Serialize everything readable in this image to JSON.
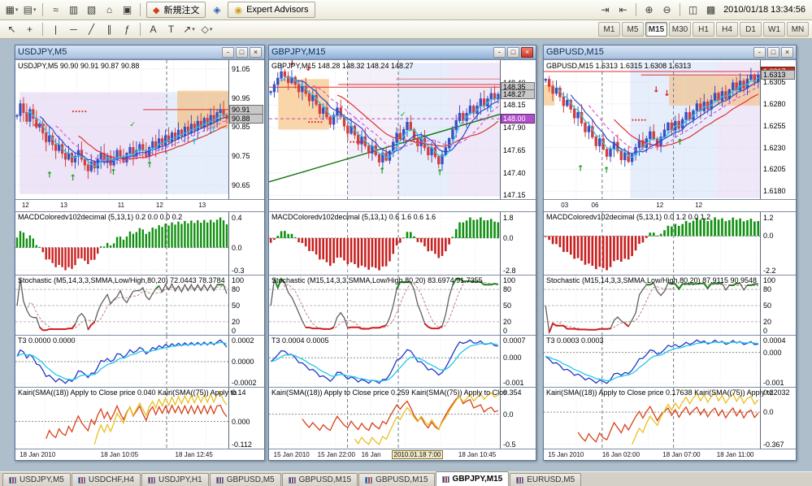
{
  "app": {
    "datetime": "2010/01/18 13:34:56"
  },
  "colors": {
    "bull": "#3a50c0",
    "bear": "#d04040",
    "ma_red": "#e03030",
    "ma_magenta": "#d858d8",
    "ma_blue": "#3048d0",
    "ma_cyan": "#28c8e8",
    "macd_pos": "#109010",
    "macd_neg": "#c82020",
    "stoch_main": "#606060",
    "stoch_high": "#208020",
    "stoch_low": "#d02020",
    "t3_line1": "#2038c8",
    "t3_line2": "#20c8e8",
    "kairi_fast": "#d84018",
    "kairi_slow": "#e8c020"
  },
  "toolbar_top": {
    "left": [
      {
        "name": "new-chart-button",
        "glyph": "▦",
        "dropdown": true
      },
      {
        "name": "profiles-button",
        "glyph": "▤",
        "dropdown": true
      },
      {
        "name": "separator"
      },
      {
        "name": "tick-chart-button",
        "glyph": "≈"
      },
      {
        "name": "market-watch-button",
        "glyph": "▥"
      },
      {
        "name": "data-window-button",
        "glyph": "▧"
      },
      {
        "name": "navigator-button",
        "glyph": "⌂"
      },
      {
        "name": "terminal-button",
        "glyph": "▣"
      }
    ],
    "new_order_icon": "◆",
    "new_order_label": "新規注文",
    "metaeditor_icon": "◈",
    "expert_advisors_icon": "◉",
    "expert_advisors_label": "Expert Advisors",
    "right": [
      {
        "name": "auto-scroll-button",
        "glyph": "⇥"
      },
      {
        "name": "chart-shift-button",
        "glyph": "⇤"
      },
      {
        "name": "separator"
      },
      {
        "name": "zoom-in-button",
        "glyph": "⊕"
      },
      {
        "name": "zoom-out-button",
        "glyph": "⊖"
      },
      {
        "name": "separator"
      },
      {
        "name": "tile-windows-button",
        "glyph": "◫"
      },
      {
        "name": "cascade-windows-button",
        "glyph": "▩"
      }
    ]
  },
  "toolbar_draw": {
    "items": [
      {
        "name": "cursor-tool",
        "glyph": "↖"
      },
      {
        "name": "crosshair-tool",
        "glyph": "+"
      },
      {
        "name": "separator"
      },
      {
        "name": "vertical-line-tool",
        "glyph": "|"
      },
      {
        "name": "horizontal-line-tool",
        "glyph": "─"
      },
      {
        "name": "trendline-tool",
        "glyph": "╱"
      },
      {
        "name": "channel-tool",
        "glyph": "∥"
      },
      {
        "name": "fibonacci-tool",
        "glyph": "ƒ"
      },
      {
        "name": "separator"
      },
      {
        "name": "text-tool",
        "glyph": "A"
      },
      {
        "name": "text-label-tool",
        "glyph": "T"
      },
      {
        "name": "arrows-tool",
        "glyph": "↗",
        "dropdown": true
      },
      {
        "name": "shapes-tool",
        "glyph": "◇",
        "dropdown": true
      }
    ]
  },
  "timeframes": {
    "items": [
      "M1",
      "M5",
      "M15",
      "M30",
      "H1",
      "H4",
      "D1",
      "W1",
      "MN"
    ],
    "active": "M15"
  },
  "tabs": {
    "items": [
      "USDJPY,M5",
      "USDCHF,H4",
      "USDJPY,H1",
      "GBPUSD,M5",
      "GBPUSD,M15",
      "GBPUSD,M15",
      "GBPJPY,M15",
      "EURUSD,M5"
    ],
    "active_index": 6
  },
  "windows": [
    {
      "title": "USDJPY,M5",
      "active": false,
      "header": "USDJPY,M5 90.90 90.91 90.87 90.88",
      "price_axis": {
        "min": 90.6,
        "max": 91.08,
        "ticks": [
          "91.05",
          "90.95",
          "90.85",
          "90.75",
          "90.65"
        ],
        "markers": [
          {
            "v": "90.91",
            "p": 90.91,
            "bg": "#c8c8c8",
            "fg": "#000000"
          },
          {
            "v": "90.88",
            "p": 90.88,
            "bg": "#c8c8c8",
            "fg": "#000000"
          }
        ]
      },
      "mid_axis": [
        {
          "t": "12",
          "f": 0.03
        },
        {
          "t": "13",
          "f": 0.21
        },
        {
          "t": "11",
          "f": 0.48
        },
        {
          "t": "12",
          "f": 0.66
        },
        {
          "t": "13",
          "f": 0.86
        }
      ],
      "bottom_axis": [
        {
          "t": "18 Jan 2010",
          "f": 0.02
        },
        {
          "t": "18 Jan 10:05",
          "f": 0.4
        },
        {
          "t": "18 Jan 12:45",
          "f": 0.75
        }
      ],
      "chart_data": {
        "type": "candlestick",
        "wick_amp": 0.035,
        "closes": [
          90.89,
          90.93,
          90.9,
          90.87,
          90.91,
          90.88,
          90.85,
          90.86,
          90.83,
          90.8,
          90.82,
          90.79,
          90.77,
          90.79,
          90.76,
          90.74,
          90.76,
          90.73,
          90.75,
          90.77,
          90.74,
          90.72,
          90.7,
          90.73,
          90.71,
          90.74,
          90.76,
          90.73,
          90.75,
          90.72,
          90.74,
          90.77,
          90.75,
          90.73,
          90.76,
          90.78,
          90.75,
          90.77,
          90.79,
          90.77,
          90.75,
          90.78,
          90.8,
          90.78,
          90.81,
          90.79,
          90.82,
          90.8,
          90.83,
          90.81,
          90.84,
          90.82,
          90.85,
          90.83,
          90.86,
          90.84,
          90.87,
          90.85,
          90.88,
          90.86,
          90.89,
          90.87,
          90.9,
          90.91,
          90.89,
          90.88
        ]
      },
      "regions": [
        {
          "x0": 0.02,
          "x1": 0.7,
          "p0": 90.97,
          "p1": 90.62,
          "c": "rgba(214,198,238,0.45)"
        },
        {
          "x0": 0.7,
          "x1": 1.0,
          "p0": 90.97,
          "p1": 90.62,
          "c": "rgba(205,220,248,0.50)"
        },
        {
          "x0": 0.76,
          "x1": 1.0,
          "p0": 90.975,
          "p1": 90.845,
          "c": "rgba(246,178,96,0.55)"
        }
      ],
      "hlines": [
        {
          "p": 90.91,
          "x0": 0.6,
          "x1": 1.0,
          "c": "#e03030"
        }
      ],
      "trendlines": [],
      "separators": [
        0.71
      ],
      "annotations": [
        {
          "g": "↑",
          "x": 0.16,
          "p": 90.685,
          "c": "#18a018"
        },
        {
          "g": "↑",
          "x": 0.27,
          "p": 90.675,
          "c": "#18a018"
        },
        {
          "g": "↑",
          "x": 0.46,
          "p": 90.695,
          "c": "#18a018"
        },
        {
          "g": "↑",
          "x": 0.63,
          "p": 90.72,
          "c": "#18a018"
        },
        {
          "g": "↑",
          "x": 0.84,
          "p": 90.8,
          "c": "#20c0d8"
        },
        {
          "g": "↑",
          "x": 0.93,
          "p": 90.84,
          "c": "#20c0d8"
        },
        {
          "g": "•••••",
          "x": 0.3,
          "p": 90.905,
          "c": "#e03030"
        },
        {
          "g": "•••••",
          "x": 0.12,
          "p": 90.86,
          "c": "#e03030"
        },
        {
          "g": "✓",
          "x": 0.55,
          "p": 90.86,
          "c": "#18a018"
        }
      ],
      "panes": [
        {
          "kind": "macd",
          "label": "MACDColoredv102decimal (5,13,1) 0.2 0.0 0.0 0.2",
          "axis": [
            "0.4",
            "0.0",
            "-0.3"
          ]
        },
        {
          "kind": "stoch",
          "label": "Stochastic (M5,14,3,3,SMMA,Low/High,80,20) 72.0443 78.3784",
          "axis": [
            "100",
            "80",
            "50",
            "20",
            "0"
          ]
        },
        {
          "kind": "t3",
          "label": "T3 0.0000 0.0000",
          "axis": [
            "0.0002",
            "0.0000",
            "-0.0002"
          ]
        },
        {
          "kind": "kairi",
          "label": "Kairi(SMA((18)) Apply to Close price 0.040 Kairi(SMA((75)) Apply to",
          "axis": [
            "0.14",
            "0.000",
            "-0.112"
          ]
        }
      ]
    },
    {
      "title": "GBPJPY,M15",
      "active": true,
      "header": "GBPJPY,M15 148.28 148.32 148.24 148.27",
      "price_axis": {
        "min": 147.1,
        "max": 148.65,
        "ticks": [
          "148.40",
          "148.15",
          "147.90",
          "147.65",
          "147.40",
          "147.15"
        ],
        "markers": [
          {
            "v": "148.35",
            "p": 148.35,
            "bg": "#c8c8c8",
            "fg": "#000000",
            "line": "#e03030"
          },
          {
            "v": "148.27",
            "p": 148.27,
            "bg": "#c8c8c8",
            "fg": "#000000"
          },
          {
            "v": "148.00",
            "p": 148.0,
            "bg": "#b050c8",
            "fg": "#ffffff",
            "line": "#cc44cc",
            "dash": "4,3"
          }
        ]
      },
      "mid_axis": [],
      "bottom_axis": [
        {
          "t": "15 Jan 2010",
          "f": 0.02
        },
        {
          "t": "15 Jan 22:00",
          "f": 0.21
        },
        {
          "t": "16 Jan",
          "f": 0.4
        },
        {
          "t": "2010.01.18 7:00",
          "f": 0.53,
          "boxed": true
        },
        {
          "t": "18 Jan 10:45",
          "f": 0.82
        }
      ],
      "chart_data": {
        "type": "candlestick",
        "wick_amp": 0.1,
        "closes": [
          148.3,
          148.38,
          148.45,
          148.52,
          148.47,
          148.4,
          148.46,
          148.38,
          148.3,
          148.36,
          148.28,
          148.2,
          148.26,
          148.16,
          148.06,
          148.12,
          148.02,
          147.94,
          148.04,
          148.12,
          148.02,
          147.92,
          147.84,
          147.92,
          147.82,
          147.72,
          147.8,
          147.7,
          147.62,
          147.7,
          147.6,
          147.52,
          147.62,
          147.54,
          147.64,
          147.74,
          147.84,
          147.78,
          147.88,
          147.96,
          147.88,
          147.78,
          147.7,
          147.78,
          147.68,
          147.6,
          147.68,
          147.58,
          147.5,
          147.6,
          147.68,
          147.78,
          147.88,
          147.98,
          148.06,
          147.98,
          148.06,
          148.14,
          148.06,
          148.14,
          148.22,
          148.14,
          148.22,
          148.28,
          148.22,
          148.27
        ]
      },
      "regions": [
        {
          "x0": 0.04,
          "x1": 0.26,
          "p0": 148.44,
          "p1": 147.88,
          "c": "rgba(246,178,96,0.55)"
        },
        {
          "x0": 0.34,
          "x1": 0.56,
          "p0": 148.62,
          "p1": 147.14,
          "c": "rgba(220,205,240,0.30)"
        },
        {
          "x0": 0.56,
          "x1": 0.78,
          "p0": 148.62,
          "p1": 147.14,
          "c": "rgba(205,220,248,0.50)"
        },
        {
          "x0": 0.78,
          "x1": 1.0,
          "p0": 148.62,
          "p1": 147.14,
          "c": "rgba(214,198,238,0.40)"
        }
      ],
      "hlines": [
        {
          "p": 148.38,
          "x0": 0.3,
          "x1": 1.0,
          "c": "#e03030"
        },
        {
          "p": 148.44,
          "x0": 0.55,
          "x1": 1.0,
          "c": "#e08080"
        }
      ],
      "trendlines": [
        {
          "x0": 0.0,
          "p0": 147.3,
          "x1": 1.0,
          "p1": 148.05,
          "c": "#1a7a1a",
          "w": 1.5
        }
      ],
      "separators": [
        0.34,
        0.56
      ],
      "annotations": [
        {
          "g": "↓",
          "x": 0.1,
          "p": 148.62,
          "c": "#d02020"
        },
        {
          "g": "↓",
          "x": 0.17,
          "p": 148.56,
          "c": "#d02020"
        },
        {
          "g": "↑",
          "x": 0.49,
          "p": 147.42,
          "c": "#18a018"
        },
        {
          "g": "↑",
          "x": 0.74,
          "p": 147.4,
          "c": "#18a018"
        },
        {
          "g": "•••••",
          "x": 0.2,
          "p": 147.97,
          "c": "#e03030"
        },
        {
          "g": "•••••",
          "x": 0.38,
          "p": 147.75,
          "c": "#e03030"
        },
        {
          "g": "✓",
          "x": 0.58,
          "p": 148.05,
          "c": "#18a018"
        },
        {
          "g": "↑",
          "x": 0.96,
          "p": 148.1,
          "c": "#20c0d8"
        }
      ],
      "panes": [
        {
          "kind": "macd",
          "label": "MACDColoredv102decimal (5,13,1) 0.6 1.6 0.6 1.6",
          "axis": [
            "1.8",
            "0.0",
            "-2.8"
          ]
        },
        {
          "kind": "stoch",
          "label": "Stochastic (M15,14,3,3,SMMA,Low/High,80,20) 83.6974 91.7355",
          "axis": [
            "100",
            "80",
            "50",
            "20",
            "0"
          ]
        },
        {
          "kind": "t3",
          "label": "T3 0.0004 0.0005",
          "axis": [
            "0.0007",
            "0.000",
            "-0.001"
          ]
        },
        {
          "kind": "kairi",
          "label": "Kairi(SMA((18)) Apply to Close price 0.259 Kairi(SMA((75)) Apply to Clos",
          "axis": [
            "0.354",
            "0.0",
            "-0.5"
          ]
        }
      ]
    },
    {
      "title": "GBPUSD,M15",
      "active": false,
      "header": "GBPUSD,M15 1.6313 1.6315 1.6308 1.6313",
      "price_axis": {
        "min": 1.617,
        "max": 1.633,
        "ticks": [
          "1.6305",
          "1.6280",
          "1.6255",
          "1.6230",
          "1.6205",
          "1.6180"
        ],
        "markers": [
          {
            "v": "1.6317",
            "p": 1.6317,
            "bg": "#c03020",
            "fg": "#ffffff",
            "line": "#e03030"
          },
          {
            "v": "1.6313",
            "p": 1.6313,
            "bg": "#c8c8c8",
            "fg": "#000000"
          }
        ]
      },
      "mid_axis": [
        {
          "t": "03",
          "f": 0.08
        },
        {
          "t": "06",
          "f": 0.22
        },
        {
          "t": "12",
          "f": 0.52
        },
        {
          "t": "12",
          "f": 0.7
        }
      ],
      "bottom_axis": [
        {
          "t": "15 Jan 2010",
          "f": 0.02
        },
        {
          "t": "16 Jan 02:00",
          "f": 0.27
        },
        {
          "t": "18 Jan 07:00",
          "f": 0.55
        },
        {
          "t": "18 Jan 11:00",
          "f": 0.8
        }
      ],
      "chart_data": {
        "type": "candlestick",
        "wick_amp": 0.001,
        "closes": [
          1.6308,
          1.63,
          1.6292,
          1.6298,
          1.6288,
          1.6278,
          1.6284,
          1.6274,
          1.6264,
          1.627,
          1.6258,
          1.6248,
          1.6254,
          1.6242,
          1.6232,
          1.624,
          1.6228,
          1.622,
          1.6228,
          1.6236,
          1.6226,
          1.6216,
          1.6224,
          1.6214,
          1.6222,
          1.623,
          1.6238,
          1.623,
          1.624,
          1.6248,
          1.624,
          1.6232,
          1.6242,
          1.625,
          1.6258,
          1.625,
          1.626,
          1.6252,
          1.6262,
          1.627,
          1.6262,
          1.6272,
          1.628,
          1.6272,
          1.6282,
          1.6274,
          1.6284,
          1.6292,
          1.6284,
          1.6294,
          1.6286,
          1.6296,
          1.6304,
          1.6296,
          1.6306,
          1.6298,
          1.6308,
          1.6313,
          1.6305,
          1.6313
        ]
      },
      "regions": [
        {
          "x0": 0.0,
          "x1": 0.05,
          "p0": 1.6302,
          "p1": 1.6278,
          "c": "rgba(246,178,96,0.55)"
        },
        {
          "x0": 0.4,
          "x1": 0.8,
          "p0": 1.6328,
          "p1": 1.6172,
          "c": "rgba(205,220,248,0.50)"
        },
        {
          "x0": 0.8,
          "x1": 1.0,
          "p0": 1.6328,
          "p1": 1.6172,
          "c": "rgba(214,198,238,0.40)"
        },
        {
          "x0": 0.58,
          "x1": 1.0,
          "p0": 1.6312,
          "p1": 1.6278,
          "c": "rgba(246,178,96,0.50)"
        }
      ],
      "hlines": [
        {
          "p": 1.6313,
          "x0": 0.45,
          "x1": 1.0,
          "c": "#e03030"
        }
      ],
      "trendlines": [],
      "separators": [
        0.27,
        0.6
      ],
      "annotations": [
        {
          "g": "↓",
          "x": 0.52,
          "p": 1.6296,
          "c": "#d02020"
        },
        {
          "g": "↓",
          "x": 0.57,
          "p": 1.6292,
          "c": "#d02020"
        },
        {
          "g": "↑",
          "x": 0.17,
          "p": 1.6206,
          "c": "#18a018"
        },
        {
          "g": "↑",
          "x": 0.29,
          "p": 1.6204,
          "c": "#18a018"
        },
        {
          "g": "↑",
          "x": 0.63,
          "p": 1.6236,
          "c": "#18a018"
        },
        {
          "g": "•••••",
          "x": 0.44,
          "p": 1.6262,
          "c": "#e03030"
        },
        {
          "g": "↑",
          "x": 0.9,
          "p": 1.6296,
          "c": "#20c0d8"
        }
      ],
      "panes": [
        {
          "kind": "macd",
          "label": "MACDColoredv102decimal (5,13,1) 0.0 1.2 0.0 1.2",
          "axis": [
            "1.2",
            "0.0",
            "-2.2"
          ]
        },
        {
          "kind": "stoch",
          "label": "Stochastic (M15,14,3,3,SMMA,Low/High,80,20) 87.9115 90.9548",
          "axis": [
            "100",
            "80",
            "50",
            "20",
            "0"
          ]
        },
        {
          "kind": "t3",
          "label": "T3 0.0003 0.0003",
          "axis": [
            "0.0004",
            "0.000",
            "-0.001"
          ]
        },
        {
          "kind": "kairi",
          "label": "Kairi(SMA((18)) Apply to Close price 0.17638 Kairi(SMA((75)) Apply to",
          "axis": [
            "0.22032",
            "0.0",
            "-0.367"
          ]
        }
      ]
    }
  ]
}
